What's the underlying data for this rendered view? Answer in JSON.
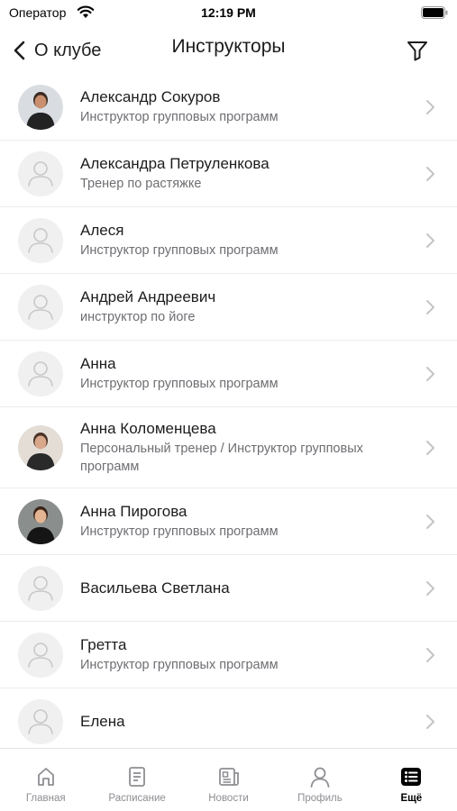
{
  "status_bar": {
    "carrier": "Оператор",
    "time": "12:19 PM"
  },
  "nav": {
    "back_label": "О клубе",
    "title": "Инструкторы"
  },
  "instructors": [
    {
      "name": "Александр Сокуров",
      "role": "Инструктор групповых программ",
      "has_photo": true
    },
    {
      "name": "Александра Петруленкова",
      "role": "Тренер по растяжке",
      "has_photo": false
    },
    {
      "name": "Алеся",
      "role": "Инструктор групповых программ",
      "has_photo": false
    },
    {
      "name": "Андрей Андреевич",
      "role": "инструктор по йоге",
      "has_photo": false
    },
    {
      "name": "Анна",
      "role": "Инструктор групповых программ",
      "has_photo": false
    },
    {
      "name": "Анна Коломенцева",
      "role": "Персональный тренер / Инструктор групповых программ",
      "has_photo": true
    },
    {
      "name": "Анна Пирогова",
      "role": "Инструктор групповых программ",
      "has_photo": true
    },
    {
      "name": "Васильева Светлана",
      "role": "",
      "has_photo": false
    },
    {
      "name": "Гретта",
      "role": "Инструктор групповых программ",
      "has_photo": false
    },
    {
      "name": "Елена",
      "role": "",
      "has_photo": false
    }
  ],
  "tabs": [
    {
      "label": "Главная",
      "icon": "home-icon",
      "active": false
    },
    {
      "label": "Расписание",
      "icon": "schedule-icon",
      "active": false
    },
    {
      "label": "Новости",
      "icon": "news-icon",
      "active": false
    },
    {
      "label": "Профиль",
      "icon": "profile-icon",
      "active": false
    },
    {
      "label": "Ещё",
      "icon": "more-icon",
      "active": true
    }
  ]
}
